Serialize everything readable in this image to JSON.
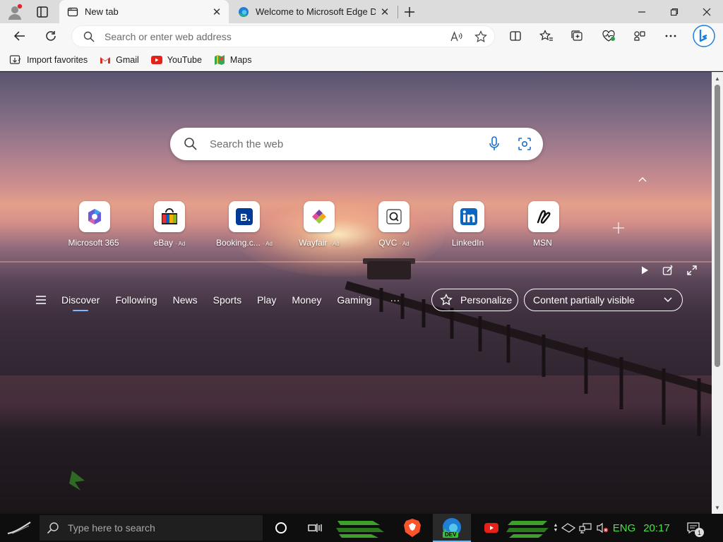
{
  "browser": {
    "tabs": [
      {
        "title": "New tab",
        "active": true
      },
      {
        "title": "Welcome to Microsoft Edge Dev",
        "active": false
      }
    ],
    "address_placeholder": "Search or enter web address",
    "favorites": [
      {
        "label": "Import favorites",
        "icon": "import-icon"
      },
      {
        "label": "Gmail",
        "icon": "gmail-icon"
      },
      {
        "label": "YouTube",
        "icon": "youtube-icon"
      },
      {
        "label": "Maps",
        "icon": "maps-icon"
      }
    ]
  },
  "newtab": {
    "search_placeholder": "Search the web",
    "tiles": [
      {
        "label": "Microsoft 365",
        "ad": "",
        "icon": "microsoft365-icon"
      },
      {
        "label": "eBay",
        "ad": "· Ad",
        "icon": "ebay-icon"
      },
      {
        "label": "Booking.c...",
        "ad": "· Ad",
        "icon": "booking-icon"
      },
      {
        "label": "Wayfair",
        "ad": "· Ad",
        "icon": "wayfair-icon"
      },
      {
        "label": "QVC",
        "ad": "· Ad",
        "icon": "qvc-icon"
      },
      {
        "label": "LinkedIn",
        "ad": "",
        "icon": "linkedin-icon"
      },
      {
        "label": "MSN",
        "ad": "",
        "icon": "msn-icon"
      }
    ],
    "feed_tabs": [
      "Discover",
      "Following",
      "News",
      "Sports",
      "Play",
      "Money",
      "Gaming"
    ],
    "more_label": "···",
    "personalize_label": "Personalize",
    "content_label": "Content partially visible"
  },
  "taskbar": {
    "search_placeholder": "Type here to search",
    "language": "ENG",
    "time": "20:17",
    "notification_count": "1",
    "edge_badge": "DEV"
  }
}
